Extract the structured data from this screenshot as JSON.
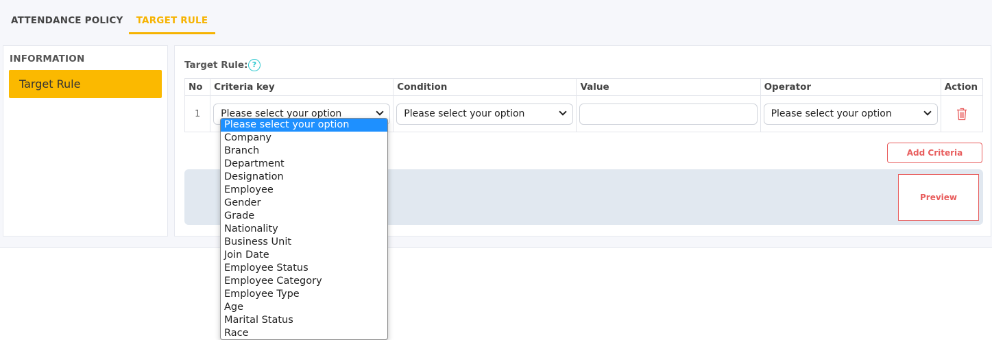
{
  "tabs": [
    {
      "label": "ATTENDANCE POLICY",
      "active": false
    },
    {
      "label": "TARGET RULE",
      "active": true
    }
  ],
  "sidebar": {
    "heading": "INFORMATION",
    "items": [
      {
        "label": "Target Rule",
        "active": true
      }
    ]
  },
  "main": {
    "title": "Target Rule:",
    "help_icon": "question-circle-icon",
    "table": {
      "headers": {
        "no": "No",
        "criteria_key": "Criteria key",
        "condition": "Condition",
        "value": "Value",
        "operator": "Operator",
        "action": "Action"
      },
      "rows": [
        {
          "no": "1",
          "criteria_key": "Please select your option",
          "condition": "Please select your option",
          "value": "",
          "operator": "Please select your option",
          "action_icon": "trash-icon"
        }
      ]
    },
    "add_button": "Add Criteria",
    "preview_button": "Preview"
  },
  "dropdown": {
    "options": [
      "Please select your option",
      "Company",
      "Branch",
      "Department",
      "Designation",
      "Employee",
      "Gender",
      "Grade",
      "Nationality",
      "Business Unit",
      "Join Date",
      "Employee Status",
      "Employee Category",
      "Employee Type",
      "Age",
      "Marital Status",
      "Race"
    ],
    "highlighted": 0
  },
  "colors": {
    "accent": "#fbb900",
    "tab_active": "#f6b300",
    "danger": "#e85c5c",
    "help": "#2ec8cf",
    "highlight": "#1e90ff",
    "preview_bg": "#e1e8f0"
  }
}
